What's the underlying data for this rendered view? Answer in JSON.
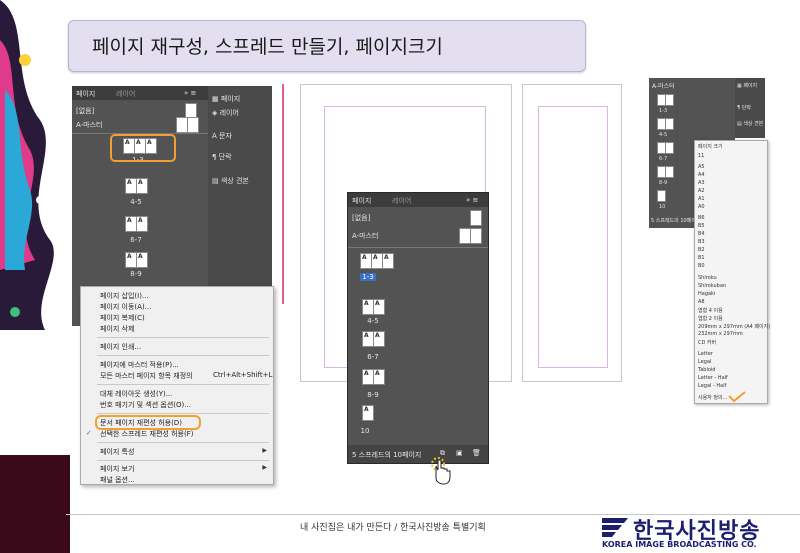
{
  "title": "페이지 재구성, 스프레드 만들기, 페이지크기",
  "panel_left": {
    "tabs": [
      "페이지",
      "레이어"
    ],
    "none_label": "[없음]",
    "master_label": "A-마스터",
    "spread_labels": [
      "1-3",
      "4-5",
      "6-7",
      "8-9"
    ],
    "side_items": [
      "페이지",
      "레이어",
      "문자",
      "단락",
      "색상 견본"
    ]
  },
  "context_menu": {
    "items": [
      {
        "label": "페이지 삽입(I)..."
      },
      {
        "label": "페이지 이동(A)..."
      },
      {
        "label": "페이지 복제(C)"
      },
      {
        "label": "페이지 삭제"
      },
      {
        "label": "페이지 인쇄..."
      },
      {
        "label": "페이지에 마스터 적용(P)..."
      },
      {
        "label": "모든 마스터 페이지 항목 재정의",
        "shortcut": "Ctrl+Alt+Shift+L"
      },
      {
        "label": "대체 레이아웃 생성(Y)..."
      },
      {
        "label": "번호 매기기 및 섹션 옵션(O)..."
      },
      {
        "label": "문서 페이지 재편성 허용(D)"
      },
      {
        "label": "선택한 스프레드 재편성 허용(F)"
      },
      {
        "label": "페이지 특성"
      },
      {
        "label": "페이지 보기"
      },
      {
        "label": "패널 옵션..."
      }
    ],
    "check": "✓",
    "submenu_arrow": "▶"
  },
  "panel_mid": {
    "tabs": [
      "페이지",
      "레이어"
    ],
    "none_label": "[없음]",
    "master_label": "A-마스터",
    "spread_labels": [
      "1-3",
      "4-5",
      "6-7",
      "8-9",
      "10"
    ],
    "status": "5 스프레드의 10페이지"
  },
  "panel_right": {
    "master_label": "A-마스터",
    "spread_labels": [
      "1-3",
      "4-5",
      "6-7",
      "8-9",
      "10"
    ],
    "side_items": [
      "페이지",
      "단락",
      "색상 견본"
    ],
    "status": "5 스프레드의 10페이지"
  },
  "page_sizes": {
    "header": "페이지 크기",
    "items": [
      "11",
      "A5",
      "A4",
      "A3",
      "A2",
      "A1",
      "A0",
      "B6",
      "B5",
      "B4",
      "B3",
      "B2",
      "B1",
      "B0",
      "Shiroku",
      "Shirokuban",
      "Hagaki",
      "A8",
      "엽함 4 이용",
      "엽함 2 이용",
      "209mm x 297mm (A4 페이지)",
      "232mm x 297mm",
      "CD 커버",
      "Letter",
      "Legal",
      "Tabloid",
      "Letter - Half",
      "Legal - Half",
      "사용자 정의..."
    ]
  },
  "footer": {
    "text": "내 사진집은 내가 만든다 / 한국사진방송 특별기획",
    "logo_korean": "한국사진방송",
    "logo_english": "KOREA IMAGE BROADCASTING CO."
  },
  "colors": {
    "panel": "#535353",
    "highlight": "#f0a030",
    "title_bg": "#e3dff0",
    "logo": "#1c1f6e"
  }
}
